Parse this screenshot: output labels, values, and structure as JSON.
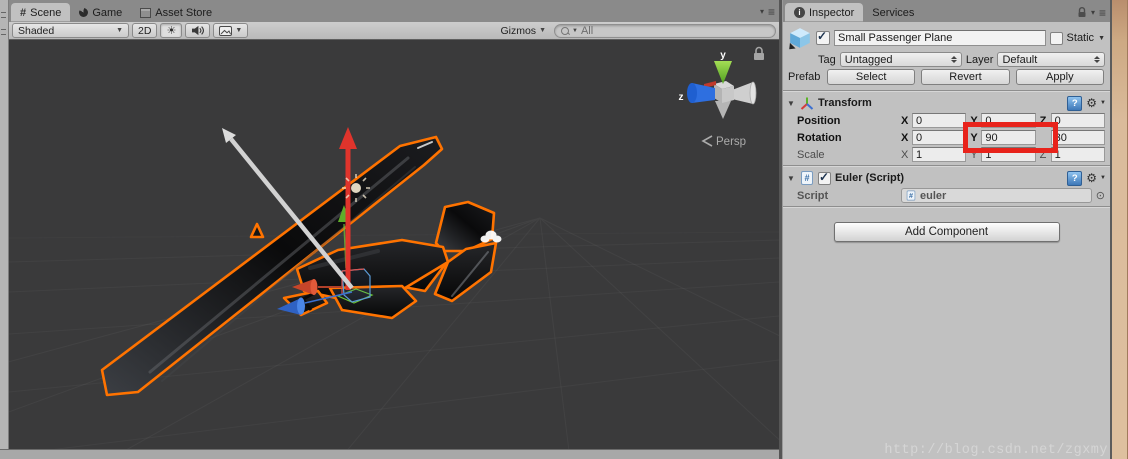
{
  "scene_panel": {
    "tabs": {
      "scene": "Scene",
      "game": "Game",
      "asset_store": "Asset Store"
    },
    "toolbar": {
      "shading_mode": "Shaded",
      "toggle_2d": "2D",
      "gizmos": "Gizmos",
      "search_filter": "All"
    },
    "viewport": {
      "camera_mode": "Persp",
      "axis_y": "y",
      "axis_z": "z"
    }
  },
  "inspector": {
    "tabs": {
      "inspector": "Inspector",
      "services": "Services"
    },
    "game_object": {
      "name": "Small Passenger Plane",
      "static_label": "Static",
      "tag_label": "Tag",
      "tag_value": "Untagged",
      "layer_label": "Layer",
      "layer_value": "Default",
      "prefab_label": "Prefab",
      "prefab_buttons": {
        "select": "Select",
        "revert": "Revert",
        "apply": "Apply"
      }
    },
    "transform": {
      "title": "Transform",
      "axis": {
        "x": "X",
        "y": "Y",
        "z": "Z"
      },
      "position": {
        "label": "Position",
        "x": "0",
        "y": "0",
        "z": "0"
      },
      "rotation": {
        "label": "Rotation",
        "x": "0",
        "y": "90",
        "z": "30"
      },
      "scale": {
        "label": "Scale",
        "x": "1",
        "y": "1",
        "z": "1"
      }
    },
    "euler_script": {
      "title": "Euler (Script)",
      "script_label": "Script",
      "script_value": "euler"
    },
    "add_component_label": "Add Component"
  },
  "watermark": "http://blog.csdn.net/zgxmy",
  "colors": {
    "selection_outline_orange": "#ff7300",
    "annotation_red": "#e8231b",
    "viewport_background": "#3a3a3b",
    "panel_background": "#c1c1c1",
    "axis_green": "#6fc93f",
    "axis_blue": "#2f6fd0",
    "axis_red": "#d9453a"
  }
}
